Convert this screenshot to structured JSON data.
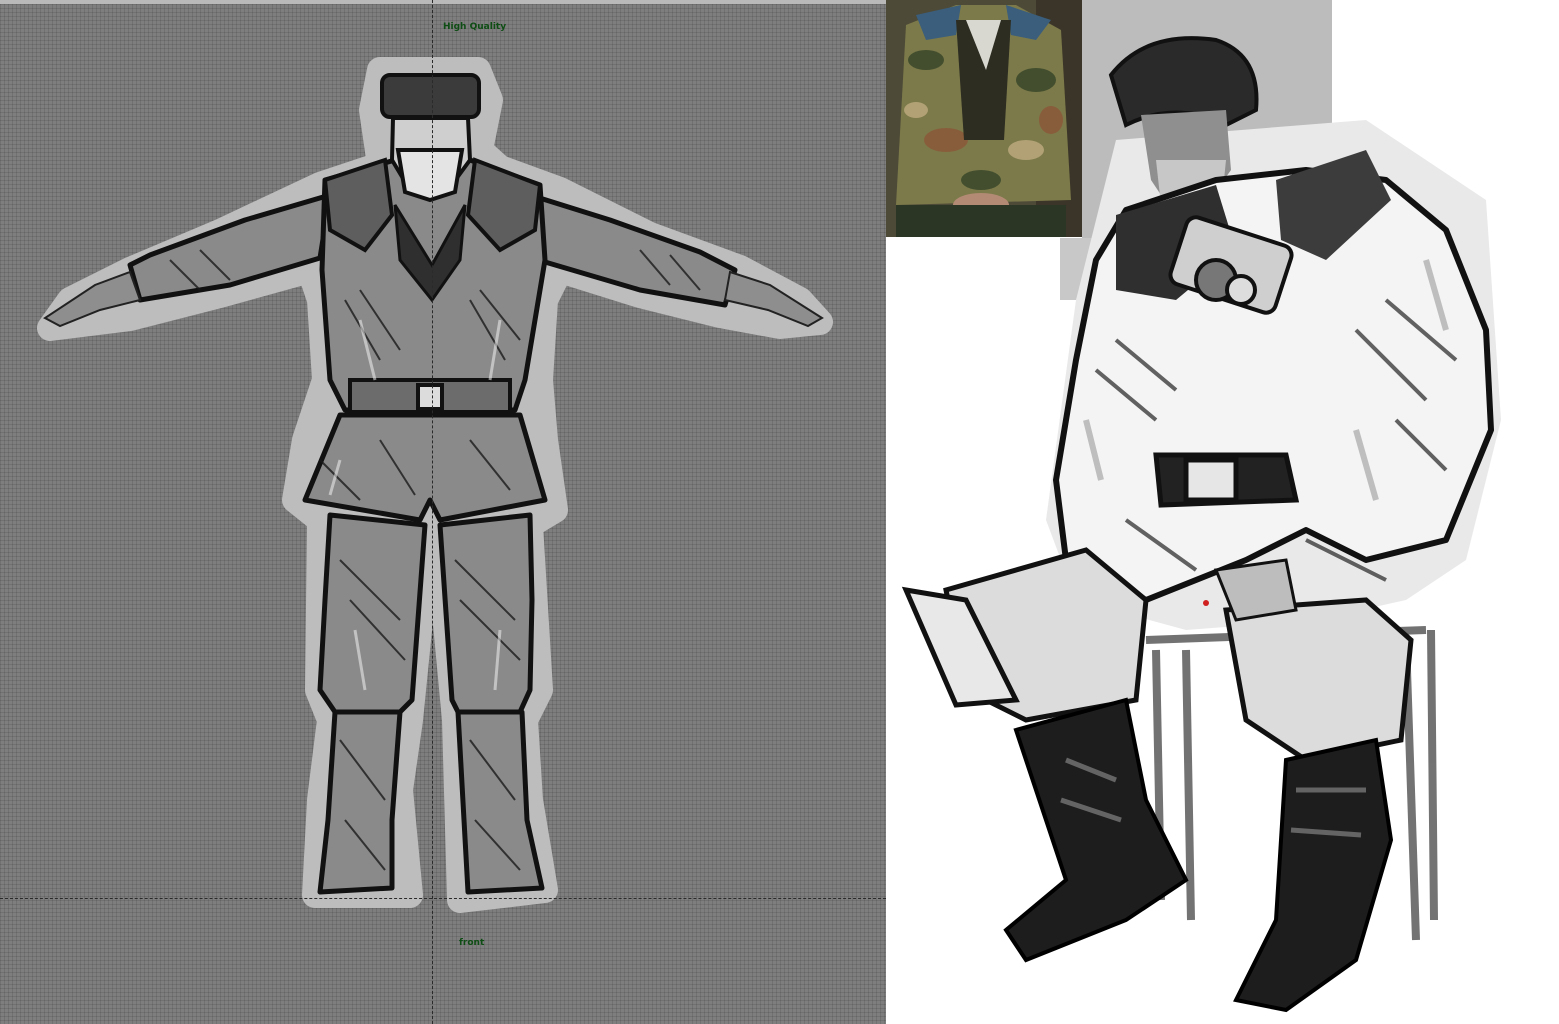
{
  "viewport": {
    "quality_label": "High Quality",
    "view_label": "front",
    "label_color": "#0e4d14",
    "background_color": "#7e7e7e"
  },
  "images": {
    "tpose_figure": "character-front-tpose-sketch",
    "reference_photo": "reference-photo-camouflage-jacket",
    "seated_sketch": "seated-soldier-concept-sketch"
  }
}
